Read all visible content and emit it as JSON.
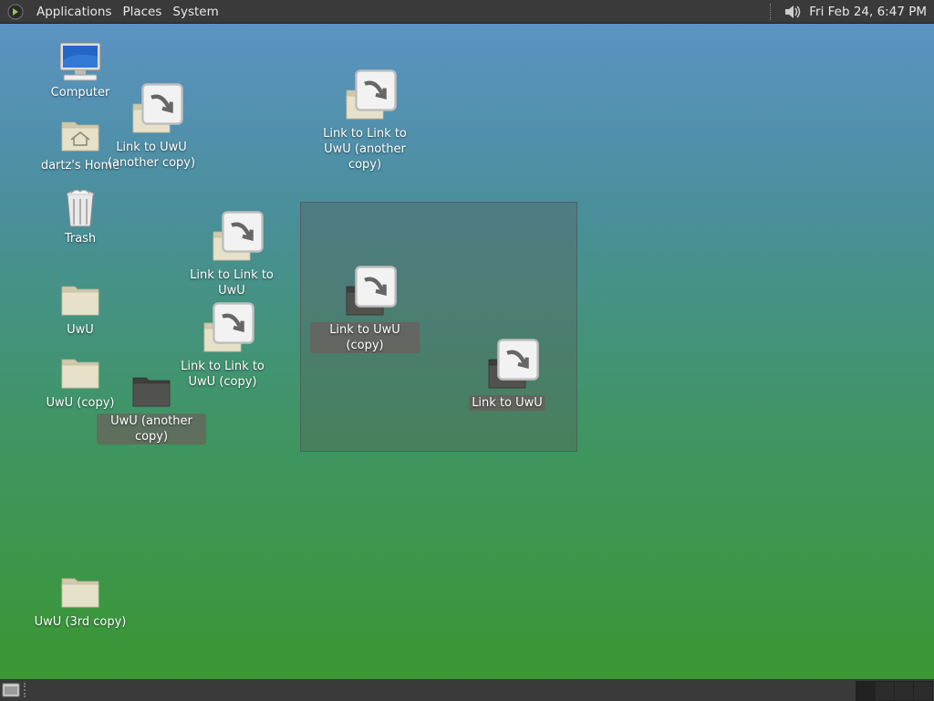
{
  "top_panel": {
    "menus": [
      "Applications",
      "Places",
      "System"
    ],
    "clock": "Fri Feb 24,  6:47 PM",
    "volume_icon": "speaker-icon"
  },
  "desktop": {
    "icons": {
      "computer": "Computer",
      "home": "dartz's Home",
      "trash": "Trash",
      "uwu": "UwU",
      "uwu_copy": "UwU (copy)",
      "uwu_another_copy": "UwU (another copy)",
      "uwu_3rd_copy": "UwU (3rd copy)",
      "link_uwu_another_copy": "Link to UwU (another copy)",
      "link_link_uwu": "Link to Link to UwU",
      "link_link_uwu_copy": "Link to Link to UwU (copy)",
      "link_link_uwu_another_copy": "Link to Link to UwU (another copy)",
      "link_uwu_copy": "Link to UwU (copy)",
      "link_uwu": "Link to UwU"
    }
  },
  "colors": {
    "panel": "#3a3a3a",
    "folder": "#e2ddc4",
    "folder_selected": "#4a4a48",
    "selection_label": "#78505a"
  }
}
